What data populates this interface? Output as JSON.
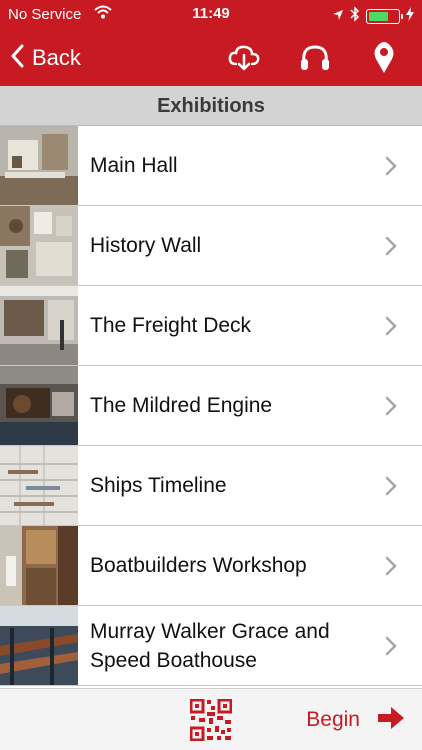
{
  "status_bar": {
    "carrier": "No Service",
    "time": "11:49"
  },
  "nav": {
    "back_label": "Back",
    "icons": [
      "cloud-download-icon",
      "headphones-icon",
      "location-pin-icon"
    ]
  },
  "section": {
    "title": "Exhibitions"
  },
  "exhibitions": [
    {
      "label": "Main Hall",
      "line2": ""
    },
    {
      "label": "History Wall",
      "line2": ""
    },
    {
      "label": "The Freight Deck",
      "line2": ""
    },
    {
      "label": "The Mildred Engine",
      "line2": ""
    },
    {
      "label": "Ships Timeline",
      "line2": ""
    },
    {
      "label": "Boatbuilders Workshop",
      "line2": ""
    },
    {
      "label": "Murray Walker Grace and",
      "line2": "Speed Boathouse"
    }
  ],
  "footer": {
    "begin_label": "Begin",
    "qr_icon": "qr-code-icon",
    "arrow_icon": "arrow-right-icon"
  },
  "colors": {
    "brand_red": "#c81a22",
    "header_gray": "#d3d3d3",
    "battery_green": "#4cd964"
  }
}
